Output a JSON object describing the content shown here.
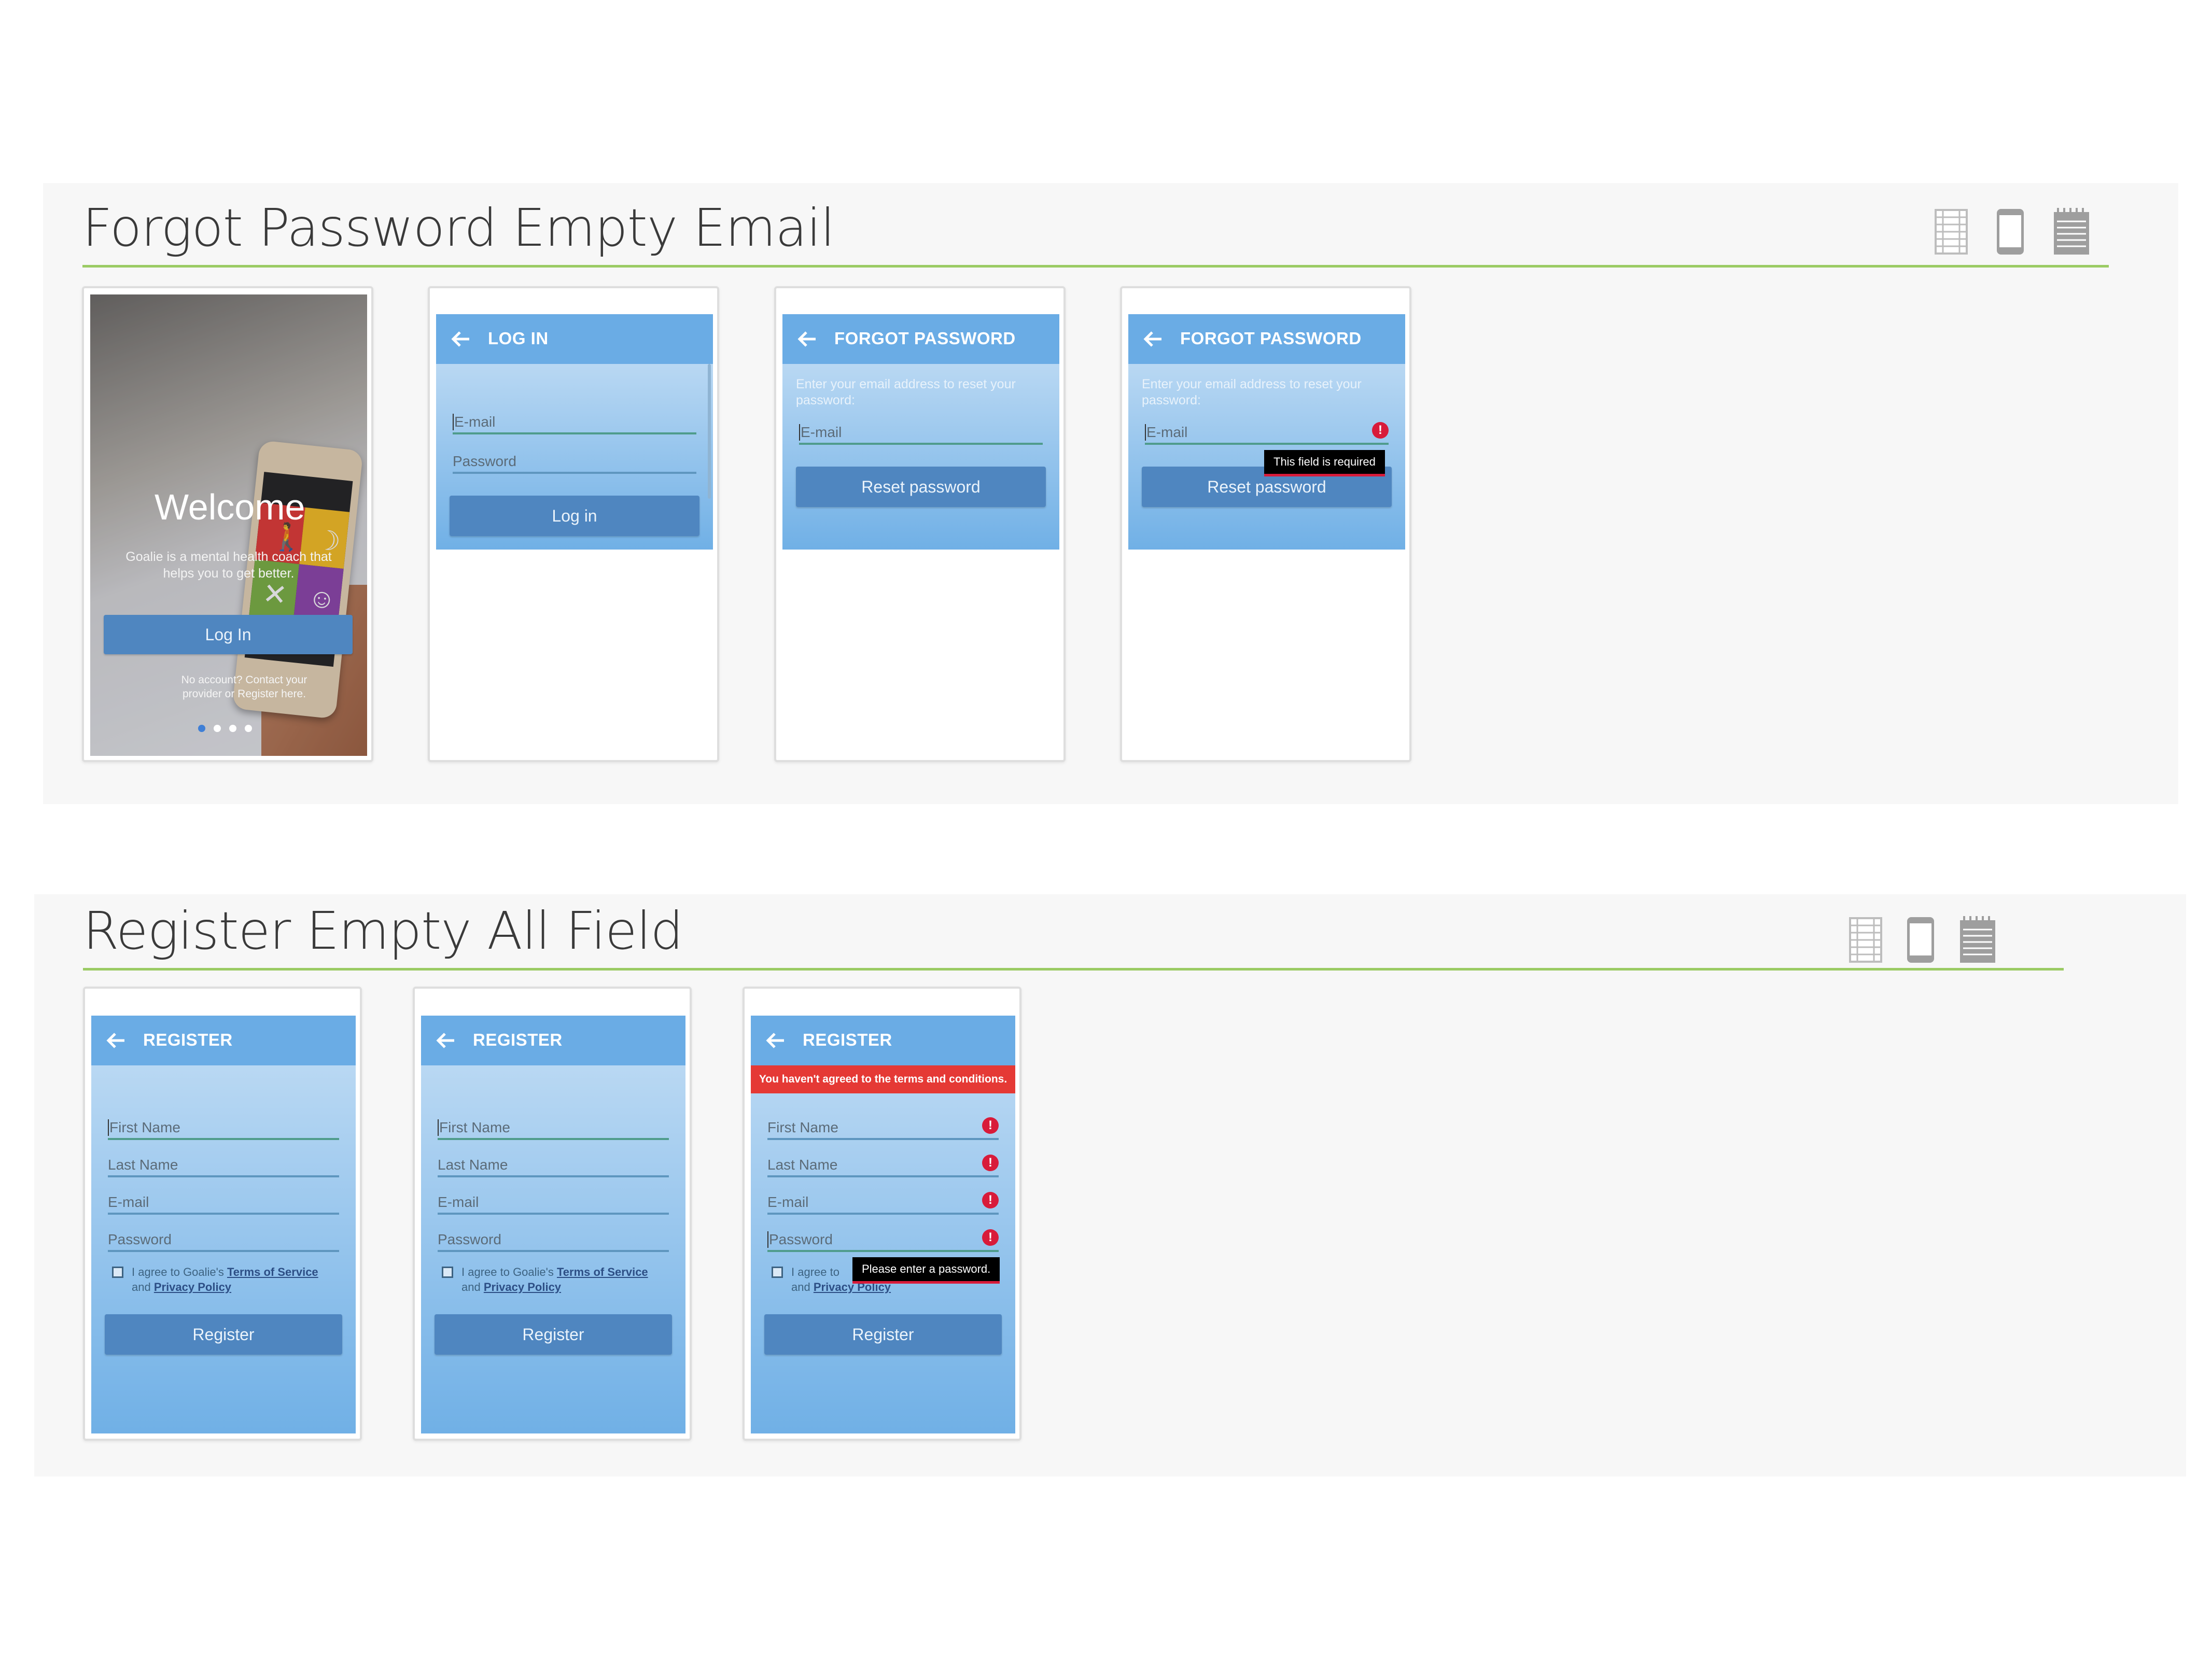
{
  "sections": [
    {
      "title": "Forgot Password Empty Email",
      "view_icons": [
        "filmstrip-icon",
        "phone-icon",
        "notepad-icon"
      ],
      "screens": {
        "welcome": {
          "heading": "Welcome",
          "tagline_line1": "Goalie is a mental health coach that",
          "tagline_line2": "helps you to get better.",
          "login_button": "Log In",
          "footer_line1": "No account? Contact your",
          "footer_line2": "provider or Register here.",
          "tiles": [
            "walking-icon",
            "moon-icon",
            "fork-knife-icon",
            "smiley-icon"
          ]
        },
        "login": {
          "appbar_title": "LOG IN",
          "email_label": "E-mail",
          "password_label": "Password",
          "button": "Log in"
        },
        "forgot": {
          "appbar_title": "FORGOT PASSWORD",
          "hint": "Enter your email address to reset your password:",
          "email_label": "E-mail",
          "button": "Reset password"
        },
        "forgot_error": {
          "appbar_title": "FORGOT PASSWORD",
          "hint": "Enter your email address to reset your password:",
          "email_label": "E-mail",
          "button": "Reset password",
          "tooltip": "This field is required"
        }
      }
    },
    {
      "title": "Register Empty All Field",
      "view_icons": [
        "filmstrip-icon",
        "phone-icon",
        "notepad-icon"
      ],
      "screens": {
        "register": {
          "appbar_title": "REGISTER",
          "first_name": "First Name",
          "last_name": "Last Name",
          "email": "E-mail",
          "password": "Password",
          "agree_prefix": "I agree to Goalie's ",
          "terms": "Terms of Service",
          "and": "and ",
          "privacy": "Privacy Policy",
          "button": "Register"
        },
        "register_error": {
          "appbar_title": "REGISTER",
          "banner": "You haven't agreed to the terms and conditions.",
          "first_name": "First Name",
          "last_name": "Last Name",
          "email": "E-mail",
          "password": "Password",
          "agree_prefix": "I agree to ",
          "and": "and ",
          "privacy": "Privacy Policy",
          "button": "Register",
          "tooltip": "Please enter a password."
        }
      }
    }
  ],
  "colors": {
    "appbar": "#6aace5",
    "button": "#4f86c0",
    "accent_rule": "#8bc34a",
    "error": "#d81b3a",
    "banner": "#e53935"
  },
  "carousel": {
    "total_dots": 4,
    "active_dot": 1
  }
}
